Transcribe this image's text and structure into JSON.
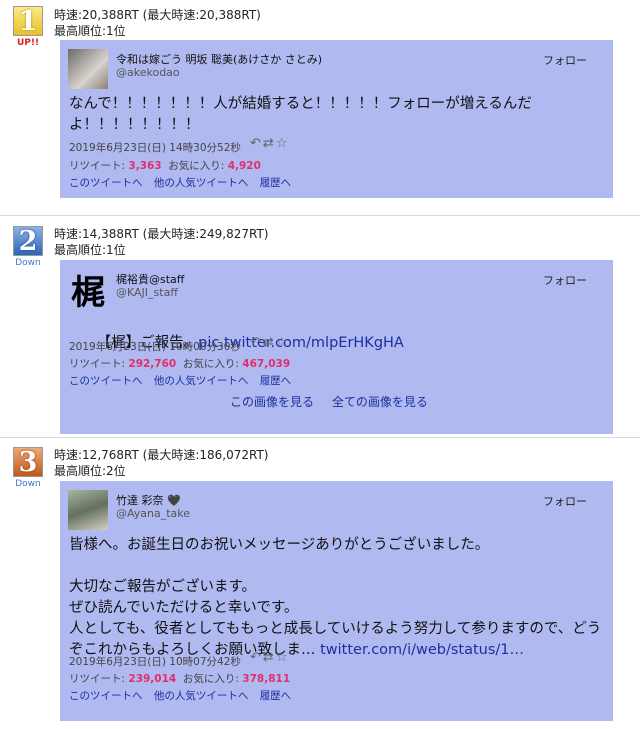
{
  "entries": [
    {
      "rank": "1",
      "change": "UP!!",
      "speed": "時速:20,388RT (最大時速:20,388RT)",
      "best": "最高順位:1位",
      "name": "令和は嫁ごう 明坂 聡美(あけさか さとみ)",
      "handle": "@akekodao",
      "follow": "フォロー",
      "text": "なんで！！！！！！！人が結婚すると！！！！！フォローが増えるんだよ！！！！！！！！",
      "date": "2019年6月23日(日) 14時30分52秒",
      "rt_label": "リツイート:",
      "rt": "3,363",
      "fav_label": "お気に入り:",
      "fav": "4,920",
      "link1": "このツイートへ",
      "link2": "他の人気ツイートへ",
      "link3": "履歴へ"
    },
    {
      "rank": "2",
      "change": "Down",
      "speed": "時速:14,388RT (最大時速:249,827RT)",
      "best": "最高順位:1位",
      "avatar_char": "梶",
      "name": "梶裕貴@staff",
      "handle": "@KAJI_staff",
      "follow": "フォロー",
      "text_prefix": "【梶】ご報告。",
      "text_link": "pic.twitter.com/mlpErHKgHA",
      "date": "2019年6月23日(日) 10時00分30秒",
      "rt_label": "リツイート:",
      "rt": "292,760",
      "fav_label": "お気に入り:",
      "fav": "467,039",
      "link1": "このツイートへ",
      "link2": "他の人気ツイートへ",
      "link3": "履歴へ",
      "img1": "この画像を見る",
      "img2": "全ての画像を見る"
    },
    {
      "rank": "3",
      "change": "Down",
      "speed": "時速:12,768RT (最大時速:186,072RT)",
      "best": "最高順位:2位",
      "name": "竹達 彩奈",
      "handle": "@Ayana_take",
      "follow": "フォロー",
      "text": "皆様へ。お誕生日のお祝いメッセージありがとうございました。\n\n大切なご報告がございます。\nぜひ読んでいただけると幸いです。\n人としても、役者としてももっと成長していけるよう努力して参りますので、どうぞこれからもよろしくお願い致しま…",
      "text_link": "twitter.com/i/web/status/1…",
      "date": "2019年6月23日(日) 10時07分42秒",
      "rt_label": "リツイート:",
      "rt": "239,014",
      "fav_label": "お気に入り:",
      "fav": "378,811",
      "link1": "このツイートへ",
      "link2": "他の人気ツイートへ",
      "link3": "履歴へ"
    }
  ]
}
